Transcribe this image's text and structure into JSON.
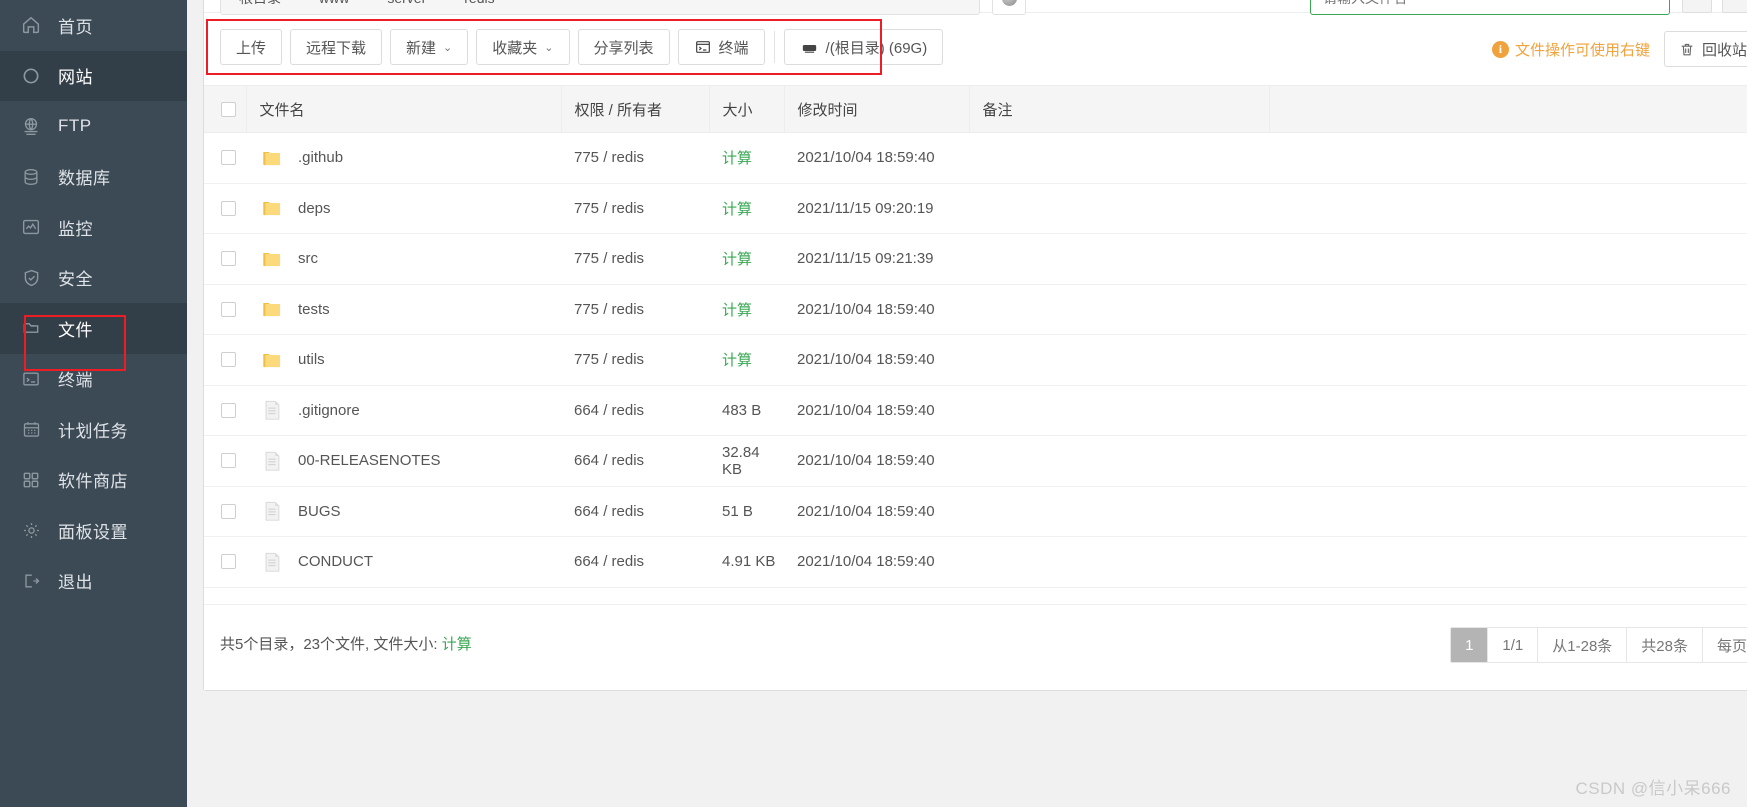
{
  "sidebar": {
    "items": [
      {
        "label": "首页",
        "icon": "home-icon",
        "active": false
      },
      {
        "label": "网站",
        "icon": "globe-circle-icon",
        "active": true
      },
      {
        "label": "FTP",
        "icon": "ftp-icon",
        "active": false
      },
      {
        "label": "数据库",
        "icon": "database-icon",
        "active": false
      },
      {
        "label": "监控",
        "icon": "monitor-chart-icon",
        "active": false
      },
      {
        "label": "安全",
        "icon": "shield-check-icon",
        "active": false
      },
      {
        "label": "文件",
        "icon": "folder-icon",
        "active": true
      },
      {
        "label": "终端",
        "icon": "terminal-icon",
        "active": false
      },
      {
        "label": "计划任务",
        "icon": "calendar-icon",
        "active": false
      },
      {
        "label": "软件商店",
        "icon": "grid-apps-icon",
        "active": false
      },
      {
        "label": "面板设置",
        "icon": "gear-icon",
        "active": false
      },
      {
        "label": "退出",
        "icon": "logout-icon",
        "active": false
      }
    ]
  },
  "pathbar": {
    "segments": [
      "根目录",
      "www",
      "server",
      "redis"
    ],
    "refresh_icon": "refresh-icon",
    "search_value": "",
    "search_placeholder": "请输入文件名"
  },
  "toolbar": {
    "upload_label": "上传",
    "remote_download_label": "远程下载",
    "new_label": "新建",
    "favorites_label": "收藏夹",
    "share_list_label": "分享列表",
    "terminal_label": "终端",
    "terminal_icon": "terminal-icon",
    "disk_label": "/(根目录) (69G)",
    "disk_icon": "harddisk-icon",
    "caret_icon": "chevron-down-icon",
    "tip_text": "文件操作可使用右键",
    "tip_icon": "info-circle-icon",
    "recycle_label": "回收站",
    "recycle_icon": "trash-icon",
    "highlight_color": "#ee1c25"
  },
  "table": {
    "columns": [
      "文件名",
      "权限 / 所有者",
      "大小",
      "修改时间",
      "备注"
    ],
    "select_all_checked": false,
    "rows": [
      {
        "name": ".github",
        "type": "folder",
        "perm": "775 / redis",
        "size": "计算",
        "size_is_link": true,
        "time": "2021/10/04 18:59:40",
        "note": ""
      },
      {
        "name": "deps",
        "type": "folder",
        "perm": "775 / redis",
        "size": "计算",
        "size_is_link": true,
        "time": "2021/11/15 09:20:19",
        "note": ""
      },
      {
        "name": "src",
        "type": "folder",
        "perm": "775 / redis",
        "size": "计算",
        "size_is_link": true,
        "time": "2021/11/15 09:21:39",
        "note": ""
      },
      {
        "name": "tests",
        "type": "folder",
        "perm": "775 / redis",
        "size": "计算",
        "size_is_link": true,
        "time": "2021/10/04 18:59:40",
        "note": ""
      },
      {
        "name": "utils",
        "type": "folder",
        "perm": "775 / redis",
        "size": "计算",
        "size_is_link": true,
        "time": "2021/10/04 18:59:40",
        "note": ""
      },
      {
        "name": ".gitignore",
        "type": "file",
        "perm": "664 / redis",
        "size": "483 B",
        "size_is_link": false,
        "time": "2021/10/04 18:59:40",
        "note": ""
      },
      {
        "name": "00-RELEASENOTES",
        "type": "file",
        "perm": "664 / redis",
        "size": "32.84 KB",
        "size_is_link": false,
        "time": "2021/10/04 18:59:40",
        "note": ""
      },
      {
        "name": "BUGS",
        "type": "file",
        "perm": "664 / redis",
        "size": "51 B",
        "size_is_link": false,
        "time": "2021/10/04 18:59:40",
        "note": ""
      },
      {
        "name": "CONDUCT",
        "type": "file",
        "perm": "664 / redis",
        "size": "4.91 KB",
        "size_is_link": false,
        "time": "2021/10/04 18:59:40",
        "note": ""
      }
    ]
  },
  "footer": {
    "summary_prefix": "共5个目录，23个文件, 文件大小: ",
    "summary_link": "计算",
    "pager": {
      "current_page": "1",
      "page_of": "1/1",
      "range": "从1-28条",
      "total": "共28条",
      "per_page_label": "每页"
    }
  },
  "watermark": "CSDN @信小呆666",
  "colors": {
    "sidebar_bg": "#3c4a55",
    "sidebar_active": "#323e48",
    "accent_green": "#3aa853",
    "accent_orange": "#f0a23c",
    "highlight_red": "#ee1c25"
  }
}
